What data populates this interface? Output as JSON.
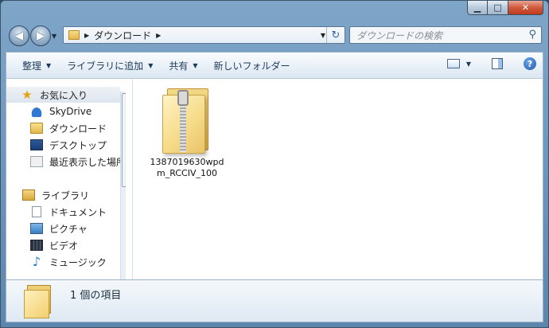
{
  "window": {
    "min_glyph": "▁",
    "max_glyph": "□",
    "close_glyph": "✕"
  },
  "nav": {
    "back_glyph": "◀",
    "forward_glyph": "▶",
    "address_crumbs": [
      "ダウンロード"
    ],
    "search_placeholder": "ダウンロードの検索"
  },
  "toolbar": {
    "organize": "整理",
    "add_to_library": "ライブラリに追加",
    "share": "共有",
    "new_folder": "新しいフォルダー",
    "help_glyph": "?"
  },
  "sidebar": {
    "favorites": {
      "label": "お気に入り",
      "icon": "star-icon"
    },
    "favorite_items": [
      {
        "label": "SkyDrive",
        "icon": "cloud-icon"
      },
      {
        "label": "ダウンロード",
        "icon": "downloads-folder-icon"
      },
      {
        "label": "デスクトップ",
        "icon": "desktop-icon"
      },
      {
        "label": "最近表示した場所",
        "icon": "recent-places-icon"
      }
    ],
    "libraries": {
      "label": "ライブラリ",
      "icon": "library-icon"
    },
    "library_items": [
      {
        "label": "ドキュメント",
        "icon": "document-icon"
      },
      {
        "label": "ピクチャ",
        "icon": "picture-icon"
      },
      {
        "label": "ビデオ",
        "icon": "video-icon"
      },
      {
        "label": "ミュージック",
        "icon": "music-icon"
      }
    ]
  },
  "files": [
    {
      "name_line1": "1387019630wpd",
      "name_line2": "m_RCCIV_100",
      "icon": "zip-folder-icon"
    }
  ],
  "details": {
    "count_text": "1 個の項目"
  }
}
